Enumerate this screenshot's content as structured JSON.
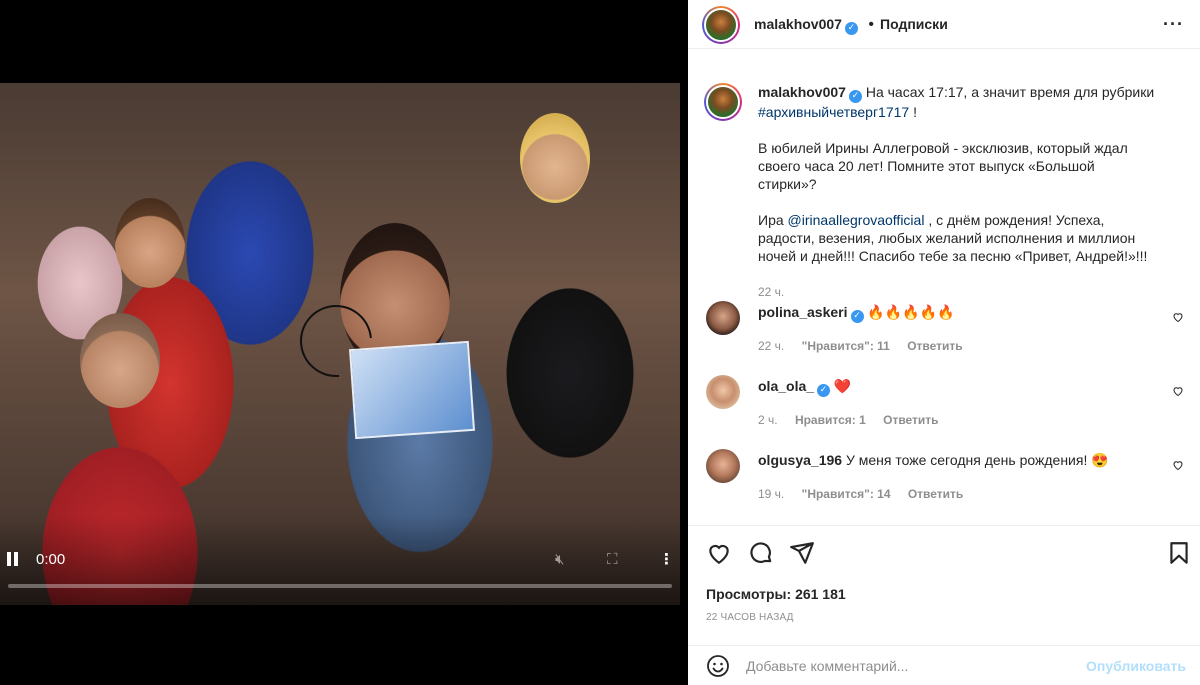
{
  "video": {
    "time": "0:00",
    "progress": 0.0
  },
  "post": {
    "author": "malakhov007",
    "follow_label": "Подписки",
    "caption_intro": "На часах 17:17, а значит время для рубрики",
    "caption_hashtag": "#архивныйчетверг1717",
    "caption_hashtag_tail": "!",
    "caption_p2": "В юбилей Ирины Аллегровой - эксклюзив, который ждал своего часа 20 лет! Помните этот выпуск «Большой стирки»?",
    "caption_p3_before": "Ира",
    "caption_mention": "@irinaallegrovaofficial",
    "caption_p3_after": ", с днём рождения! Успеха, радости, везения, любых желаний исполнения и миллион ночей и дней!!! Спасибо тебе за песню «Привет, Андрей!»!!!",
    "caption_time": "22 ч."
  },
  "comments": [
    {
      "user": "polina_askeri",
      "verified": true,
      "text": "🔥🔥🔥🔥🔥",
      "time": "22 ч.",
      "likes": "\"Нравится\": 11",
      "reply": "Ответить"
    },
    {
      "user": "ola_ola_",
      "verified": true,
      "text": "❤️",
      "time": "2 ч.",
      "likes": "Нравится: 1",
      "reply": "Ответить"
    },
    {
      "user": "olgusya_196",
      "verified": false,
      "text": "У меня тоже сегодня день рождения! 😍",
      "time": "19 ч.",
      "likes": "\"Нравится\": 14",
      "reply": "Ответить"
    }
  ],
  "stats": {
    "views_label": "Просмотры:",
    "views_value": "261 181",
    "posted_ago": "22 ЧАСОВ НАЗАД"
  },
  "add_comment": {
    "placeholder": "Добавьте комментарий...",
    "publish_label": "Опубликовать"
  },
  "icons": {
    "heart": "heart-icon",
    "comment": "comment-icon",
    "share": "share-icon",
    "save": "bookmark-icon",
    "emoji": "emoji-icon",
    "more": "more-icon"
  }
}
